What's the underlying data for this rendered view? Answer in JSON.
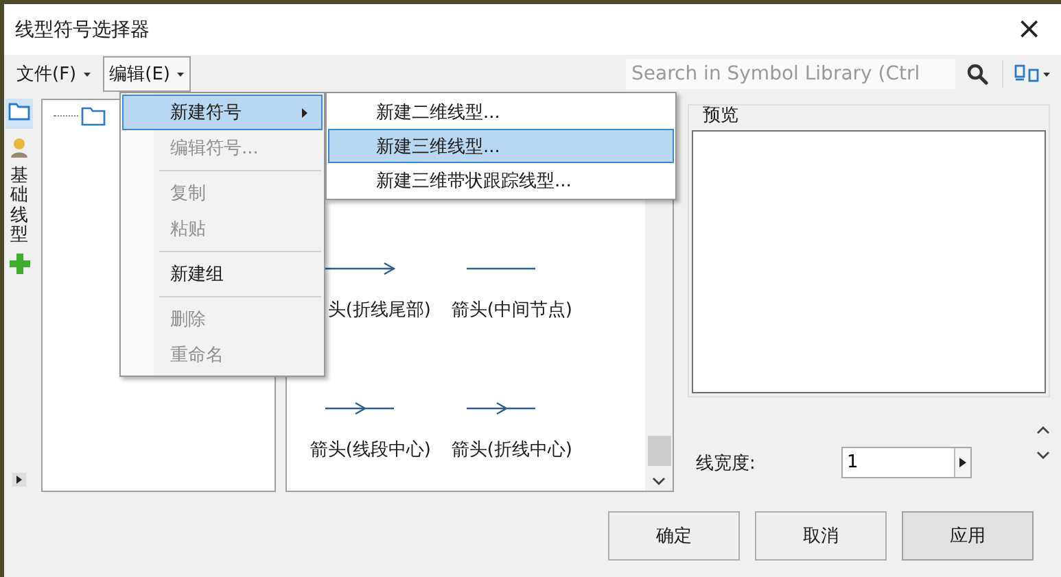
{
  "window": {
    "title": "线型符号选择器",
    "close": "×"
  },
  "menubar": {
    "items": [
      {
        "label": "文件(F)",
        "open": false
      },
      {
        "label": "编辑(E)",
        "open": true
      }
    ],
    "search": {
      "placeholder": "Search in Symbol Library (Ctrl"
    }
  },
  "side_strip": {
    "label": "基础线型"
  },
  "symbols": [
    {
      "label": "头(折线尾部)",
      "kind": "end"
    },
    {
      "label": "箭头(中间节点)",
      "kind": "plain"
    },
    {
      "label": "箭头(线段中心)",
      "kind": "center"
    },
    {
      "label": "箭头(折线中心)",
      "kind": "center"
    }
  ],
  "preview": {
    "title": "预览"
  },
  "line_width": {
    "label": "线宽度:",
    "value": "1"
  },
  "buttons": [
    {
      "label": "确定",
      "default": false
    },
    {
      "label": "取消",
      "default": false
    },
    {
      "label": "应用",
      "default": true
    }
  ],
  "edit_menu": [
    {
      "kind": "item",
      "label": "新建符号",
      "submenu": true,
      "selected": true,
      "disabled": false
    },
    {
      "kind": "item",
      "label": "编辑符号...",
      "submenu": false,
      "selected": false,
      "disabled": true
    },
    {
      "kind": "separator"
    },
    {
      "kind": "item",
      "label": "复制",
      "submenu": false,
      "selected": false,
      "disabled": true
    },
    {
      "kind": "item",
      "label": "粘贴",
      "submenu": false,
      "selected": false,
      "disabled": true
    },
    {
      "kind": "separator"
    },
    {
      "kind": "item",
      "label": "新建组",
      "submenu": false,
      "selected": false,
      "disabled": false
    },
    {
      "kind": "separator"
    },
    {
      "kind": "item",
      "label": "删除",
      "submenu": false,
      "selected": false,
      "disabled": true
    },
    {
      "kind": "item",
      "label": "重命名",
      "submenu": false,
      "selected": false,
      "disabled": true
    }
  ],
  "submenu": [
    {
      "label": "新建二维线型...",
      "selected": false
    },
    {
      "label": "新建三维线型...",
      "selected": true
    },
    {
      "label": "新建三维带状跟踪线型...",
      "selected": false
    }
  ]
}
